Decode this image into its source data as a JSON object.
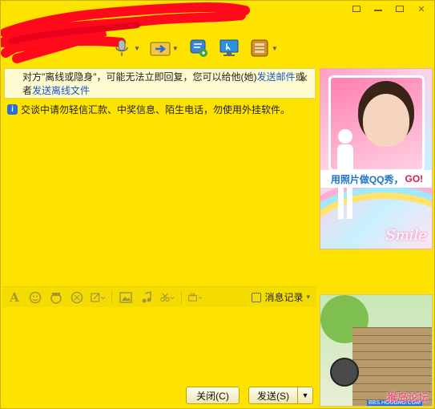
{
  "window": {
    "controls": {
      "skin": "▾",
      "minimize": "",
      "maximize": "",
      "close": "✕"
    }
  },
  "toolbar": {
    "items": [
      {
        "icon": "microphone-icon"
      },
      {
        "icon": "transfer-file-icon"
      },
      {
        "icon": "application-icon"
      },
      {
        "icon": "remote-assist-icon"
      },
      {
        "icon": "apps-icon"
      }
    ]
  },
  "notice": {
    "text_1": "对方\"离线或隐身\"，可能无法立即回复，您可以给他(她)",
    "link_1": "发送邮件",
    "text_2": "或者",
    "link_2": "发送离线文件",
    "close": "✕"
  },
  "security": {
    "icon": "i",
    "text": "交谈中请勿轻信汇款、中奖信息、陌生电话，勿使用外挂软件。"
  },
  "input_toolbar": {
    "font": "A",
    "history_label": "消息记录",
    "history_arrow": "▾"
  },
  "buttons": {
    "close": "关闭(C)",
    "send": "发送(S)",
    "send_arrow": "▼"
  },
  "ads": {
    "top": {
      "cta": "用照片做QQ秀，",
      "cta_go": "GO!",
      "logo": "Smile"
    },
    "bottom": {
      "watermark": "猴岛论坛",
      "watermark_url": "BBS.HOUDAO.COM"
    }
  },
  "colors": {
    "accent": "#ffe300",
    "link": "#1a56c8",
    "info": "#2a6fd6"
  }
}
